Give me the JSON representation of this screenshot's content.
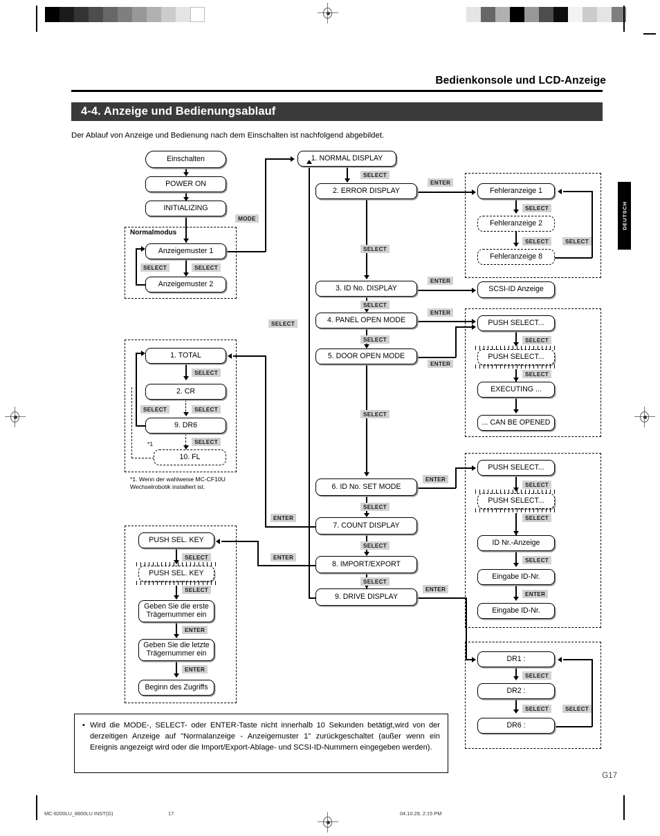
{
  "header": {
    "running_head": "Bedienkonsole und LCD-Anzeige",
    "section_title": "4-4. Anzeige und Bedienungsablauf",
    "intro": "Der Ablauf von Anzeige und Bedienung nach dem Einschalten ist nachfolgend abgebildet."
  },
  "side_tab": {
    "label": "DEUTSCH"
  },
  "keys": {
    "select": "SELECT",
    "enter": "ENTER",
    "mode": "MODE"
  },
  "flow": {
    "startup": {
      "power_on_trigger": "Einschalten",
      "power_on": "POWER ON",
      "initializing": "INITIALIZING",
      "group_label": "Normalmodus",
      "pattern1": "Anzeigemuster 1",
      "pattern2": "Anzeigemuster 2"
    },
    "main_menu": [
      "1. NORMAL DISPLAY",
      "2. ERROR DISPLAY",
      "3. ID No. DISPLAY",
      "4. PANEL OPEN MODE",
      "5. DOOR OPEN MODE",
      "6. ID No. SET MODE",
      "7. COUNT DISPLAY",
      "8. IMPORT/EXPORT",
      "9. DRIVE DISPLAY"
    ],
    "error_branch": {
      "item1": "Fehleranzeige 1",
      "item2": "Fehleranzeige 2",
      "item8": "Fehleranzeige 8"
    },
    "scsi_id_branch": "SCSI-ID Anzeige",
    "open_mode_branch": {
      "push1": "PUSH SELECT...",
      "push2": "PUSH SELECT...",
      "executing": "EXECUTING ...",
      "can_be_opened": "... CAN BE OPENED"
    },
    "id_set_branch": {
      "push1": "PUSH SELECT...",
      "push2": "PUSH SELECT...",
      "id_display": "ID Nr.-Anzeige",
      "input1": "Eingabe ID-Nr.",
      "input2": "Eingabe ID-Nr."
    },
    "count_branch": {
      "total": "1. TOTAL",
      "cr": "2. CR",
      "dr6": "9. DR6",
      "fl": "10. FL",
      "star_mark": "*1",
      "footnote": "*1. Wenn der wahlweise MC-CF10U\nWechselrobotik installiert ist."
    },
    "import_export_branch": {
      "push1": "PUSH SEL. KEY",
      "push2": "PUSH SEL. KEY",
      "first_slot": "Geben Sie die erste\nTrägernummer ein",
      "last_slot": "Geben Sie die letzte\nTrägernummer ein",
      "access_start": "Beginn des Zugriffs"
    },
    "drive_branch": {
      "dr1": "DR1 :",
      "dr2": "DR2 :",
      "dr6": "DR6 :"
    }
  },
  "note": {
    "bullet": "•",
    "text": "Wird die MODE-, SELECT- oder ENTER-Taste nicht innerhalb 10 Sekunden betätigt,wird von der derzeitigen Anzeige auf \"Normalanzeige - Anzeigemuster 1\" zurückgeschaltet (außer wenn ein Ereignis angezeigt wird oder die Import/Export-Ablage- und SCSI-ID-Nummern eingegeben werden)."
  },
  "footer": {
    "page_marker": "G17",
    "file_name": "MC-8200LU_8600LU INST(G)",
    "page_number": "17",
    "timestamp": "04.10.29, 2:15 PM"
  },
  "colors": {
    "section_bar": "#3a3a3a",
    "key_badge": "#d2d2d2",
    "side_tab": "#000000",
    "shadow": "#9a9a9a"
  }
}
